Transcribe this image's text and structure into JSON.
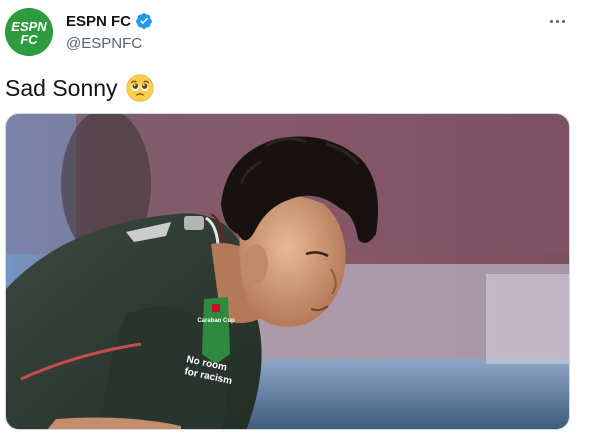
{
  "tweet": {
    "display_name": "ESPN FC",
    "handle": "@ESPNFC",
    "text": "Sad Sonny",
    "emoji": "pleading-face-emoji",
    "verified": true
  },
  "avatar": {
    "logo_text_1": "ESPN",
    "logo_text_2": "FC",
    "color": "#2e9b3f"
  },
  "media": {
    "jersey_sponsor_1": "No room",
    "jersey_sponsor_2": "for racism",
    "cup_badge": "Carabao Cup"
  },
  "colors": {
    "verified_blue": "#1d9bf0",
    "handle_gray": "#536471"
  }
}
